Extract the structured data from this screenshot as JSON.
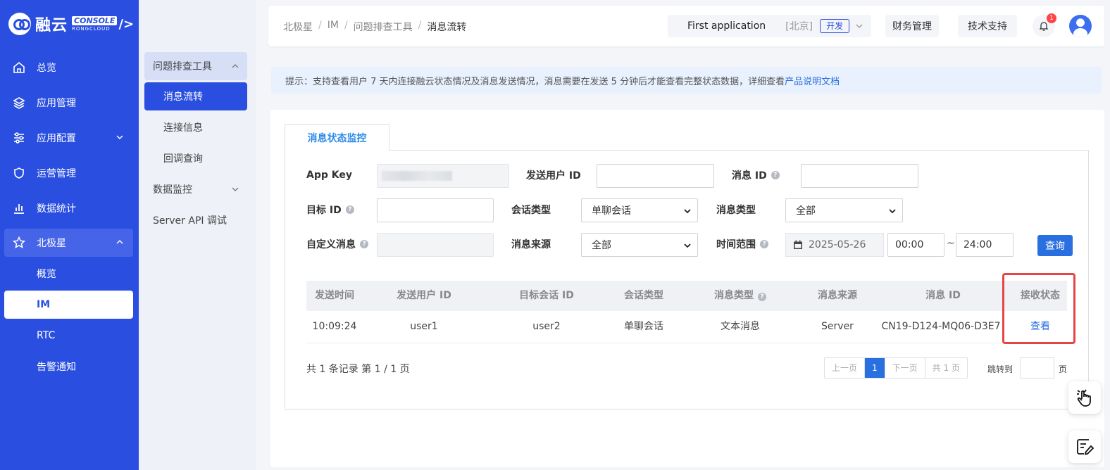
{
  "brand": {
    "name": "融云",
    "console": "CONSOLE",
    "sub": "RONGCLOUD",
    "slash": "/>"
  },
  "sidebar": {
    "items": [
      {
        "label": "总览",
        "icon": "home-icon"
      },
      {
        "label": "应用管理",
        "icon": "layers-icon"
      },
      {
        "label": "应用配置",
        "icon": "sliders-icon"
      },
      {
        "label": "运营管理",
        "icon": "shield-icon"
      },
      {
        "label": "数据统计",
        "icon": "bar-chart-icon"
      },
      {
        "label": "北极星",
        "icon": "star-icon"
      }
    ],
    "sub_items": [
      "概览",
      "IM",
      "RTC",
      "告警通知"
    ]
  },
  "subnav": {
    "group1": "问题排查工具",
    "group1_items": [
      "消息流转",
      "连接信息",
      "回调查询"
    ],
    "group2": "数据监控",
    "item3": "Server API 调试"
  },
  "header": {
    "breadcrumb": [
      "北极星",
      "IM",
      "问题排查工具",
      "消息流转"
    ],
    "app_name": "First application",
    "region": "[北京]",
    "env": "开发",
    "finance": "财务管理",
    "support": "技术支持",
    "notifications": "1"
  },
  "hint": {
    "text": "提示：支持查看用户 7 天内连接融云状态情况及消息发送情况，消息需要在发送 5 分钟后才能查看完整状态数据，详细查看",
    "link": "产品说明文档"
  },
  "tab": "消息状态监控",
  "form": {
    "app_key_label": "App Key",
    "sender_label": "发送用户 ID",
    "msg_id_label": "消息 ID",
    "target_label": "目标 ID",
    "conv_type_label": "会话类型",
    "conv_type_value": "单聊会话",
    "msg_type_label": "消息类型",
    "msg_type_value": "全部",
    "custom_label": "自定义消息",
    "source_label": "消息来源",
    "source_value": "全部",
    "time_label": "时间范围",
    "date": "2025-05-26",
    "time_start": "00:00",
    "tilde": "~",
    "time_end": "24:00",
    "query": "查询"
  },
  "table": {
    "columns": [
      "发送时间",
      "发送用户 ID",
      "目标会话 ID",
      "会话类型",
      "消息类型",
      "消息来源",
      "消息 ID",
      "接收状态"
    ],
    "rows": [
      [
        "10:09:24",
        "user1",
        "user2",
        "单聊会话",
        "文本消息",
        "Server",
        "CN19-D124-MQ06-D3E7",
        "查看"
      ]
    ]
  },
  "pagination": {
    "summary": "共 1 条记录 第 1 / 1 页",
    "prev": "上一页",
    "current": "1",
    "next": "下一页",
    "total": "共 1 页",
    "jump": "跳转到",
    "suffix": "页"
  }
}
